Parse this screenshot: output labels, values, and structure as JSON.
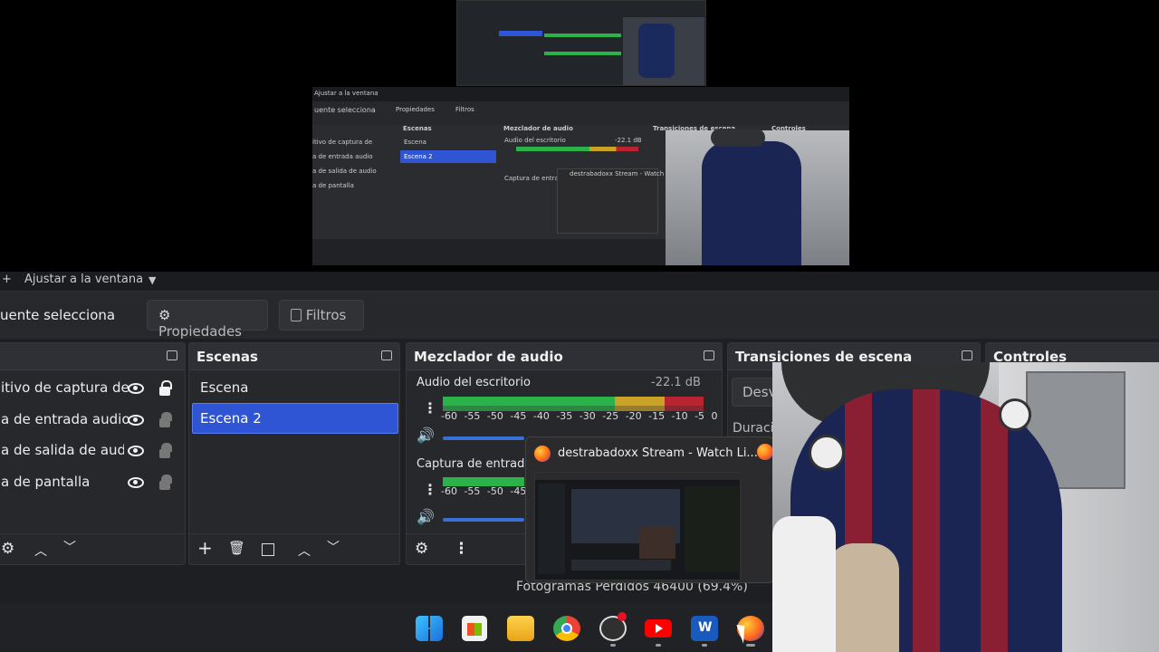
{
  "preview": {
    "nested_zoom_label": "Ajustar a la ventana",
    "nested_source_label": "uente selecciona",
    "nested_properties": "Propiedades",
    "nested_filters": "Filtros",
    "nested_scenes_title": "Escenas",
    "nested_mixer_title": "Mezclador de audio",
    "nested_transitions_title": "Transiciones de escena",
    "nested_controls_title": "Controles",
    "nested_sources": [
      "itivo de captura de",
      "a de entrada audio",
      "a de salida de audio",
      "a de pantalla"
    ],
    "nested_scenes": [
      "Escena",
      "Escena 2"
    ],
    "nested_mixer_item1": "Audio del escritorio",
    "nested_mixer_db": "-22.1 dB",
    "nested_mixer_item2": "Captura de entra",
    "nested_popup_title": "destrabadoxx Stream - Watch Li..."
  },
  "zoom": {
    "plus": "+",
    "label": "Ajustar a la ventana",
    "caret": "▼"
  },
  "source_bar": {
    "label": "uente selecciona",
    "properties": "Propiedades",
    "filters": "Filtros"
  },
  "sources_dock": {
    "items": [
      {
        "label": "itivo de captura de"
      },
      {
        "label": "a de entrada audio"
      },
      {
        "label": "a de salida de audio"
      },
      {
        "label": "a de pantalla"
      }
    ]
  },
  "scenes_dock": {
    "title": "Escenas",
    "items": [
      {
        "label": "Escena"
      },
      {
        "label": "Escena 2"
      }
    ],
    "selected_index": 1
  },
  "mixer_dock": {
    "title": "Mezclador de audio",
    "ch1": {
      "name": "Audio del escritorio",
      "db": "-22.1 dB"
    },
    "ch2": {
      "name": "Captura de entrada a"
    },
    "ticks": "-60 -55 -50 -45 -40 -35 -30 -25 -20 -15 -10 -5 0",
    "ticks_short": "-60 -55 -50 -45"
  },
  "transitions_dock": {
    "title": "Transiciones de escena",
    "mode": "Desv",
    "duration_label": "Duraci"
  },
  "controls_dock": {
    "title": "Controles"
  },
  "popup": {
    "title": "destrabadoxx Stream - Watch Li..."
  },
  "status": {
    "dropped": "Fotogramas Perdidos 46400 (69.4%)"
  },
  "colors": {
    "accent": "#2f55d4",
    "meter_green": "#2bb24a",
    "meter_yellow": "#c9a227",
    "meter_red": "#b8242f"
  }
}
